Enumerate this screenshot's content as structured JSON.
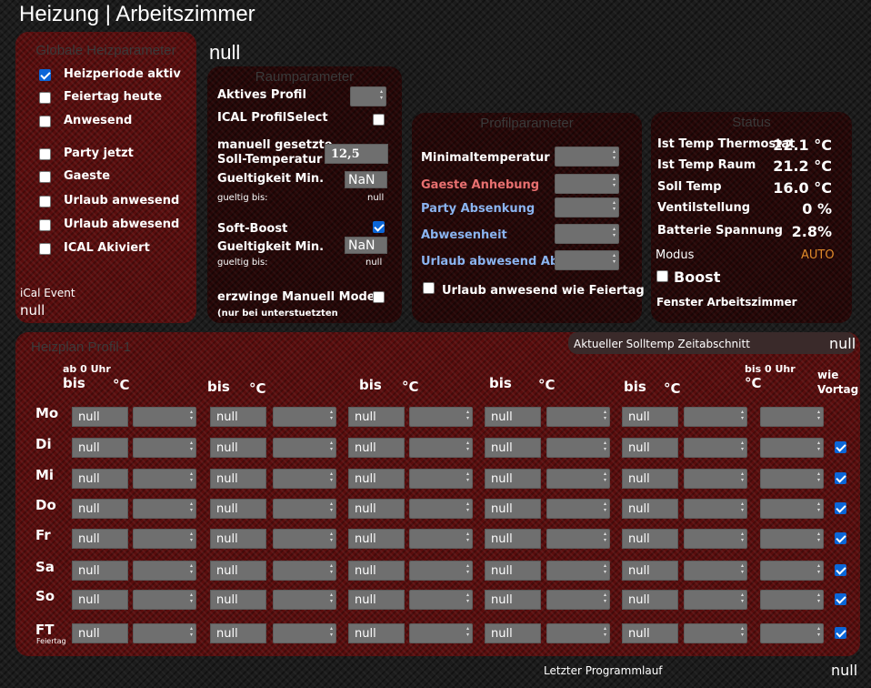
{
  "header": {
    "title": "Heizung | Arbeitszimmer",
    "value": "null"
  },
  "global": {
    "title": "Globale Heizparameter",
    "items": [
      {
        "label": "Heizperiode aktiv",
        "checked": true
      },
      {
        "label": "Feiertag heute",
        "checked": false
      },
      {
        "label": "Anwesend",
        "checked": false
      },
      {
        "label": "Party jetzt",
        "checked": false
      },
      {
        "label": "Gaeste",
        "checked": false
      },
      {
        "label": "Urlaub anwesend",
        "checked": false
      },
      {
        "label": "Urlaub abwesend",
        "checked": false
      },
      {
        "label": "ICAL Akiviert",
        "checked": false
      }
    ],
    "ical_label": "iCal Event",
    "ical_value": "null"
  },
  "room": {
    "title": "Raumparameter",
    "active_profile": "Aktives Profil",
    "ical_select": "ICAL ProfilSelect",
    "manual_temp_1": "manuell gesetzte",
    "manual_temp_2": "Soll-Temperatur",
    "manual_value": "12,5",
    "validity_1": "Gueltigkeit Min.",
    "validity_1_value": "NaN",
    "valid_until_1": "gueltig bis:",
    "valid_until_1_value": "null",
    "softboost": "Soft-Boost",
    "softboost_checked": true,
    "validity_2": "Gueltigkeit Min.",
    "validity_2_value": "NaN",
    "valid_until_2": "gueltig bis:",
    "valid_until_2_value": "null",
    "force_manual": "erzwinge Manuell Mode",
    "force_note": "(nur bei unterstuetzten"
  },
  "profile": {
    "title": "Profilparameter",
    "rows": [
      {
        "label": "Minimaltemperatur",
        "color": "#ffffff"
      },
      {
        "label": "Gaeste Anhebung",
        "color": "#e87070"
      },
      {
        "label": "Party Absenkung",
        "color": "#8ab4f0"
      },
      {
        "label": "Abwesenheit",
        "color": "#8ab4f0"
      },
      {
        "label": "Urlaub abwesend Abs.",
        "color": "#8ab4f0"
      }
    ],
    "holiday_label": "Urlaub anwesend wie Feiertag"
  },
  "status": {
    "title": "Status",
    "rows": [
      {
        "label": "Ist Temp Thermostat",
        "value": "22.1 °C"
      },
      {
        "label": "Ist Temp Raum",
        "value": "21.2 °C"
      },
      {
        "label": "Soll Temp",
        "value": "16.0 °C"
      },
      {
        "label": "Ventilstellung",
        "value": "0 %"
      },
      {
        "label": "Batterie Spannung",
        "value": "2.8%"
      }
    ],
    "mode_label": "Modus",
    "mode_value": "AUTO",
    "mode_color": "#e08a2a",
    "boost_label": "Boost",
    "window_label": "Fenster Arbeitszimmer"
  },
  "plan": {
    "title": "Heizplan Profil-1",
    "current_label": "Aktueller Solltemp Zeitabschnitt",
    "current_value": "null",
    "ab_label": "ab 0 Uhr",
    "bis_label": "bis",
    "deg_label": "°C",
    "last_bis_label": "bis 0 Uhr",
    "wie_label": "wie",
    "vortag_label": "Vortag",
    "feiertag_small": "Feiertag",
    "days": [
      "Mo",
      "Di",
      "Mi",
      "Do",
      "Fr",
      "Sa",
      "So",
      "FT"
    ],
    "cell_value": "null",
    "vortag_checked": [
      false,
      true,
      true,
      true,
      true,
      true,
      true,
      true
    ]
  },
  "footer": {
    "label": "Letzter Programmlauf",
    "value": "null"
  }
}
